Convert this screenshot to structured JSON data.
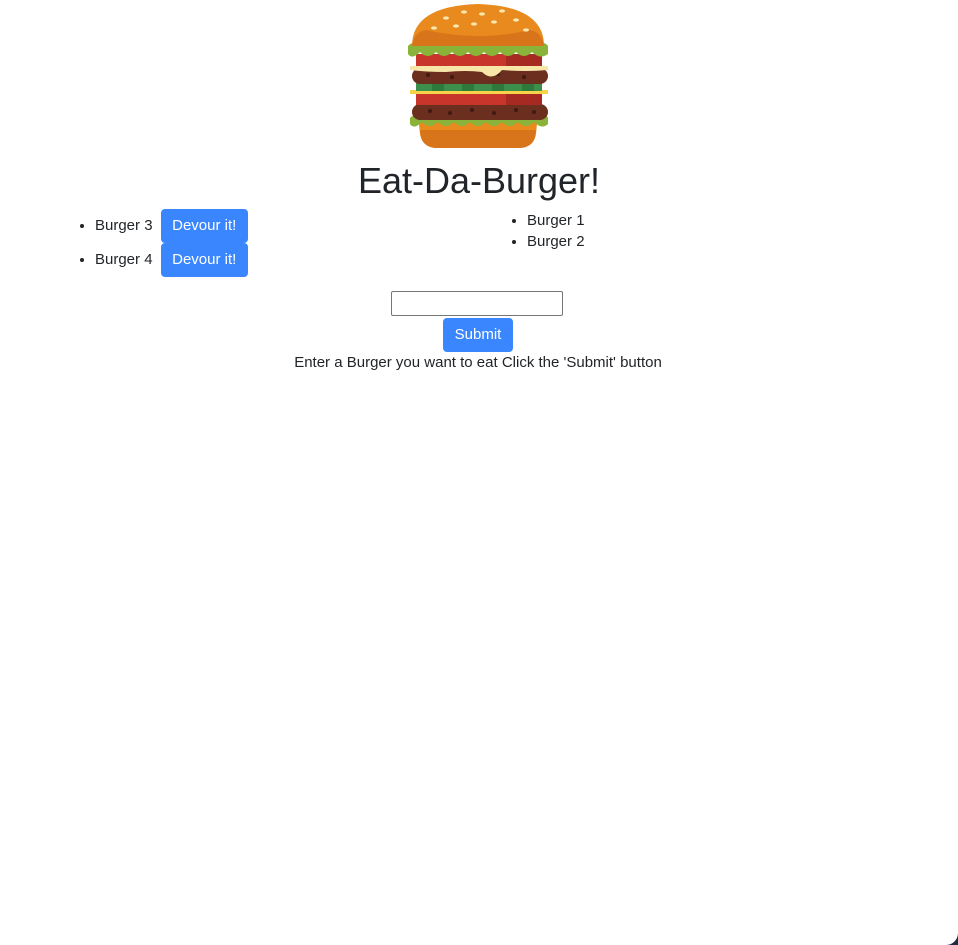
{
  "header": {
    "title": "Eat-Da-Burger!",
    "logo_icon": "burger-icon"
  },
  "not_devoured": [
    {
      "name": "Burger 3",
      "button_label": "Devour it!"
    },
    {
      "name": "Burger 4",
      "button_label": "Devour it!"
    }
  ],
  "devoured": [
    {
      "name": "Burger 1"
    },
    {
      "name": "Burger 2"
    }
  ],
  "form": {
    "input_value": "",
    "submit_label": "Submit",
    "instructions": "Enter a Burger you want to eat Click the 'Submit' button"
  },
  "colors": {
    "button_bg": "#3a86ff",
    "text": "#212529"
  }
}
